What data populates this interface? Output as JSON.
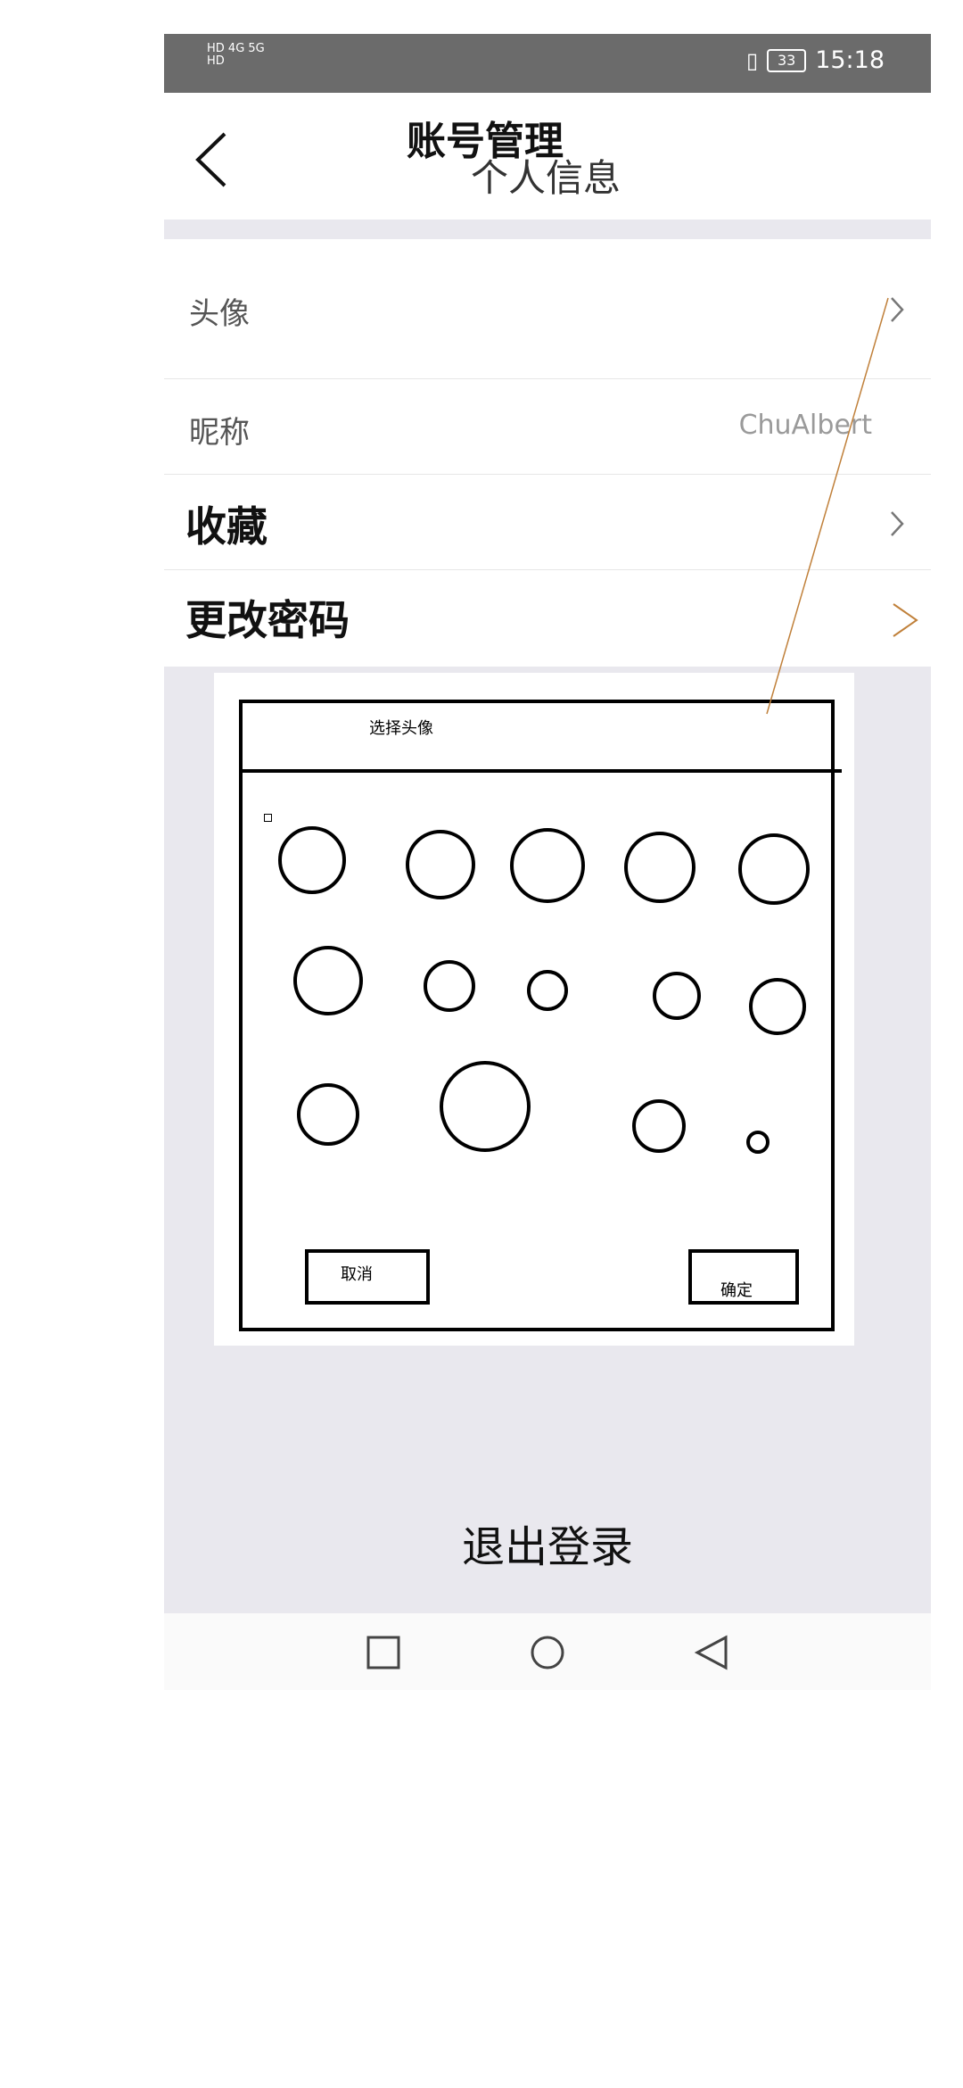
{
  "status_bar": {
    "left_line1": "HD 4G 5G",
    "left_line2": "HD",
    "battery": "33",
    "time": "15:18"
  },
  "header": {
    "title": "账号管理",
    "subtitle": "个人信息"
  },
  "rows": [
    {
      "label": "头像",
      "value": ""
    },
    {
      "label": "昵称",
      "value": "ChuAlbert"
    },
    {
      "label": "收藏",
      "value": ""
    },
    {
      "label": "更改密码",
      "value": ""
    }
  ],
  "avatar_dialog": {
    "title": "选择头像",
    "cancel": "取消",
    "confirm": "确定"
  },
  "logout_label": "退出登录",
  "icons": {
    "back": "chevron-left-icon",
    "chevron": "chevron-right-icon",
    "nav": [
      "square-icon",
      "circle-icon",
      "triangle-back-icon"
    ]
  },
  "colors": {
    "status_bar": "#6b6b6b",
    "page_bg": "#e9e8ee",
    "annotation_line": "#c0803a"
  }
}
